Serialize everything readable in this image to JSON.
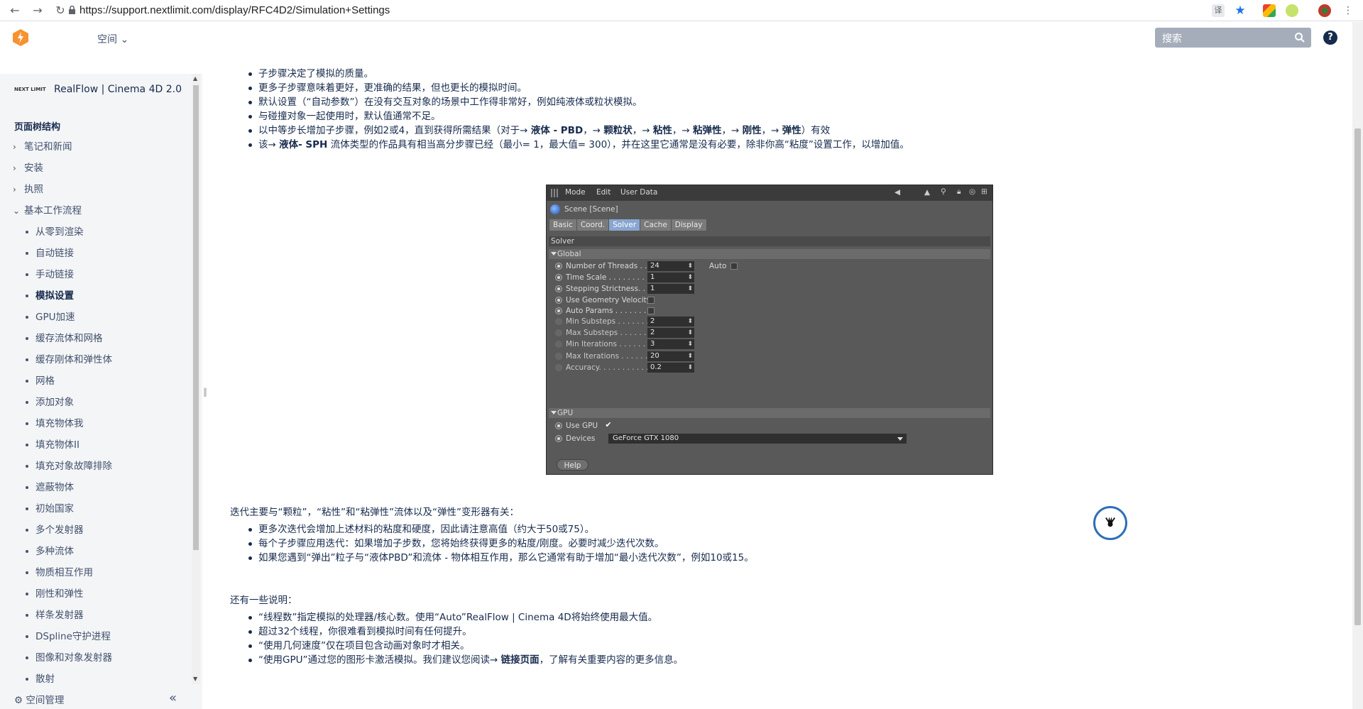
{
  "browser": {
    "url": "https://support.nextlimit.com/display/RFC4D2/Simulation+Settings"
  },
  "header": {
    "space_menu": "空间 ⌄",
    "search_placeholder": "搜索"
  },
  "sidebar": {
    "brand": "RealFlow | Cinema 4D 2.0",
    "brand_logo_text": "NEXT LIMIT",
    "tree_title": "页面树结构",
    "items": [
      {
        "label": "笔记和新闻",
        "level": 1,
        "chevron": "›"
      },
      {
        "label": "安装",
        "level": 1,
        "chevron": "›"
      },
      {
        "label": "执照",
        "level": 1,
        "chevron": "›"
      },
      {
        "label": "基本工作流程",
        "level": 1,
        "chevron": "⌄"
      },
      {
        "label": "从零到渲染",
        "level": 2
      },
      {
        "label": "自动链接",
        "level": 2
      },
      {
        "label": "手动链接",
        "level": 2
      },
      {
        "label": "模拟设置",
        "level": 2,
        "current": true
      },
      {
        "label": "GPU加速",
        "level": 2
      },
      {
        "label": "缓存流体和网格",
        "level": 2
      },
      {
        "label": "缓存刚体和弹性体",
        "level": 2
      },
      {
        "label": "网格",
        "level": 2
      },
      {
        "label": "添加对象",
        "level": 2
      },
      {
        "label": "填充物体我",
        "level": 2
      },
      {
        "label": "填充物体II",
        "level": 2
      },
      {
        "label": "填充对象故障排除",
        "level": 2
      },
      {
        "label": "遮蔽物体",
        "level": 2
      },
      {
        "label": "初始国家",
        "level": 2
      },
      {
        "label": "多个发射器",
        "level": 2
      },
      {
        "label": "多种流体",
        "level": 2
      },
      {
        "label": "物质相互作用",
        "level": 2
      },
      {
        "label": "刚性和弹性",
        "level": 2
      },
      {
        "label": "样条发射器",
        "level": 2
      },
      {
        "label": "DSpline守护进程",
        "level": 2
      },
      {
        "label": "图像和对象发射器",
        "level": 2
      },
      {
        "label": "散射",
        "level": 2
      }
    ],
    "footer": {
      "space_tools": "空间管理",
      "collapse": "«"
    }
  },
  "content": {
    "top_list": [
      {
        "parts": [
          {
            "t": "子步骤决定了模拟的质量。"
          }
        ]
      },
      {
        "parts": [
          {
            "t": "更多子步骤意味着更好，更准确的结果，但也更长的模拟时间。"
          }
        ]
      },
      {
        "parts": [
          {
            "t": "默认设置（“自动参数”）在没有交互对象的场景中工作得非常好，例如纯液体或粒状模拟。"
          }
        ]
      },
      {
        "parts": [
          {
            "t": "与碰撞对象一起使用时，默认值通常不足。"
          }
        ]
      },
      {
        "parts": [
          {
            "t": "以中等步长增加子步骤，例如2或4，直到获得所需结果（对于→ "
          },
          {
            "t": "液体 - PBD",
            "b": true
          },
          {
            "t": "，→ "
          },
          {
            "t": "颗粒状",
            "b": true
          },
          {
            "t": "，→ "
          },
          {
            "t": "粘性",
            "b": true
          },
          {
            "t": "，→ "
          },
          {
            "t": "粘弹性",
            "b": true
          },
          {
            "t": "，→ "
          },
          {
            "t": "刚性",
            "b": true
          },
          {
            "t": "，→ "
          },
          {
            "t": "弹性",
            "b": true
          },
          {
            "t": "）有效"
          }
        ]
      },
      {
        "parts": [
          {
            "t": "该→ "
          },
          {
            "t": "液体- SPH",
            "b": true
          },
          {
            "t": " 流体类型的作品具有相当高分步骤已经（最小= 1，最大值= 300），并在这里它通常是没有必要，除非你高“粘度”设置工作，以增加值。"
          }
        ]
      }
    ],
    "iterations_intro": "迭代主要与“颗粒”，“粘性”和“粘弹性”流体以及“弹性”变形器有关：",
    "iterations_list": [
      "更多次迭代会增加上述材料的粘度和硬度，因此请注意高值（约大于50或75）。",
      "每个子步骤应用迭代：如果增加子步数，您将始终获得更多的粘度/刚度。必要时减少迭代次数。",
      "如果您遇到“弹出”粒子与“液体PBD”和流体 - 物体相互作用，那么它通常有助于增加“最小迭代次数”，例如10或15。"
    ],
    "notes_intro": "还有一些说明：",
    "notes_list": [
      {
        "parts": [
          {
            "t": "“线程数”指定模拟的处理器/核心数。使用“Auto”RealFlow | Cinema 4D将始终使用最大值。"
          }
        ]
      },
      {
        "parts": [
          {
            "t": "超过32个线程，你很难看到模拟时间有任何提升。"
          }
        ]
      },
      {
        "parts": [
          {
            "t": "“使用几何速度”仅在项目包含动画对象时才相关。"
          }
        ]
      },
      {
        "parts": [
          {
            "t": "“使用GPU”通过您的图形卡激活模拟。我们建议您阅读→ "
          },
          {
            "t": "链接页面",
            "b": true
          },
          {
            "t": "，了解有关重要内容的更多信息。"
          }
        ]
      }
    ]
  },
  "c4d_panel": {
    "menu": [
      "Mode",
      "Edit",
      "User Data"
    ],
    "scene_title": "Scene [Scene]",
    "tabs": [
      {
        "label": "Basic"
      },
      {
        "label": "Coord."
      },
      {
        "label": "Solver",
        "active": true
      },
      {
        "label": "Cache"
      },
      {
        "label": "Display"
      }
    ],
    "section": "Solver",
    "global_group": "Global",
    "global_rows": [
      {
        "label": "Number of Threads . . .",
        "value": "24",
        "type": "field",
        "radio": "on"
      },
      {
        "label": "Time Scale . . . . . . . . . .",
        "value": "1",
        "type": "field",
        "radio": "on"
      },
      {
        "label": "Stepping Strictness. . .",
        "value": "1",
        "type": "field",
        "radio": "on"
      },
      {
        "label": "Use Geometry Velocity",
        "type": "check",
        "radio": "on"
      },
      {
        "label": "Auto Params . . . . . . . .",
        "type": "check",
        "radio": "on"
      },
      {
        "label": "Min Substeps . . . . . . .",
        "value": "2",
        "type": "field",
        "radio": "dim"
      },
      {
        "label": "Max Substeps . . . . . . .",
        "value": "2",
        "type": "field",
        "radio": "dim"
      },
      {
        "label": "Min Iterations . . . . . . .",
        "value": "3",
        "type": "field",
        "radio": "dim"
      },
      {
        "label": "Max Iterations . . . . . . .",
        "value": "20",
        "type": "field",
        "radio": "dim"
      },
      {
        "label": "Accuracy. . . . . . . . . . . .",
        "value": "0.2",
        "type": "field",
        "radio": "dim"
      }
    ],
    "auto_label": "Auto",
    "gpu_group": "GPU",
    "use_gpu_label": "Use GPU",
    "use_gpu_check": "✔",
    "devices_label": "Devices",
    "devices_value": "GeForce GTX 1080",
    "help_label": "Help"
  }
}
